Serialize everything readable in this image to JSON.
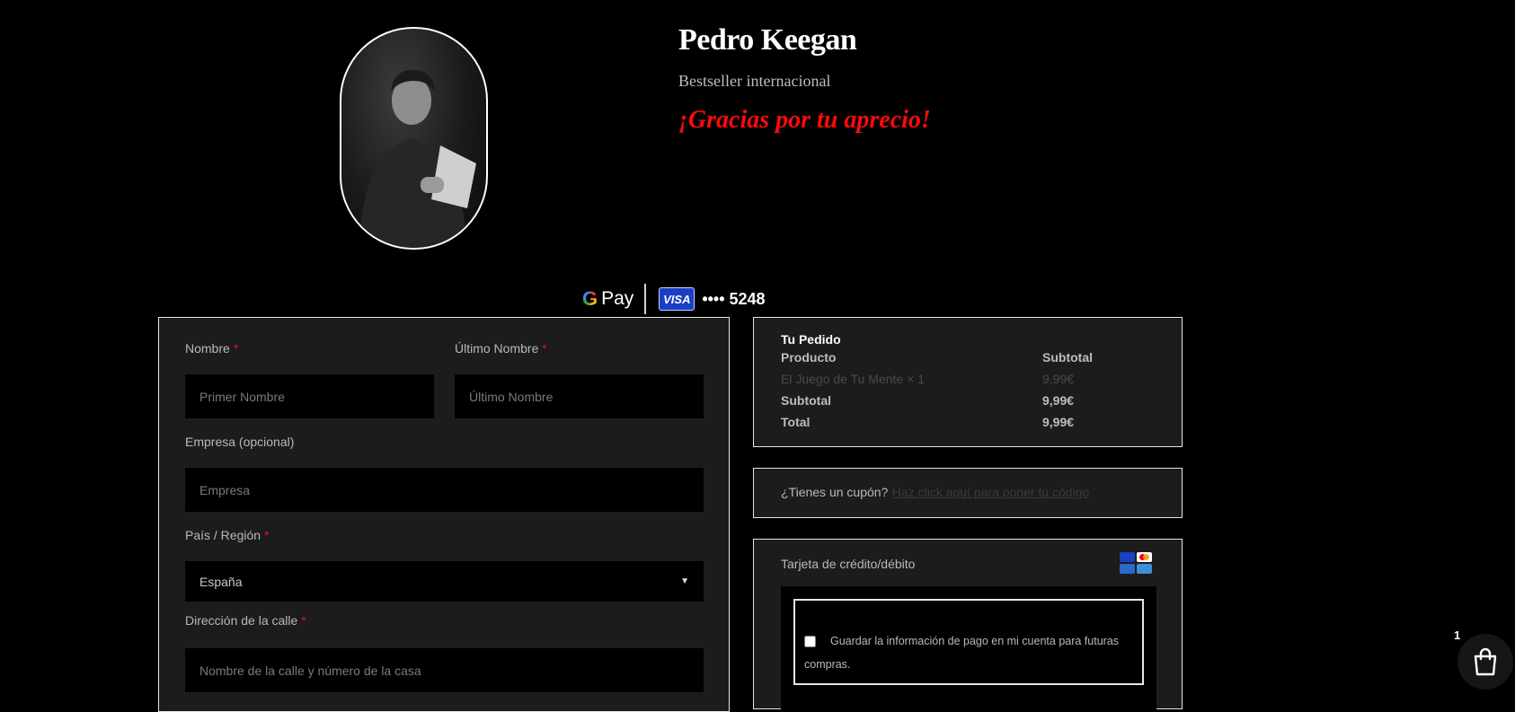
{
  "author": {
    "name": "Pedro Keegan",
    "subtitle": "Bestseller internacional",
    "thanks": "¡Gracias por tu aprecio!"
  },
  "payment_strip": {
    "gpay_label": "Pay",
    "card_brand": "VISA",
    "card_last": "•••• 5248"
  },
  "billing": {
    "first_name": {
      "label": "Nombre",
      "required": "*",
      "placeholder": "Primer Nombre"
    },
    "last_name": {
      "label": "Último Nombre",
      "required": "*",
      "placeholder": "Último Nombre"
    },
    "company": {
      "label": "Empresa (opcional)",
      "placeholder": "Empresa"
    },
    "country": {
      "label": "País / Región",
      "required": "*",
      "value": "España"
    },
    "street": {
      "label": "Dirección de la calle",
      "required": "*",
      "placeholder": "Nombre de la calle y número de la casa"
    }
  },
  "order": {
    "title": "Tu Pedido",
    "headers": {
      "product": "Producto",
      "subtotal": "Subtotal"
    },
    "items": [
      {
        "name": "El Juego de Tu Mente",
        "qty": " × 1",
        "price": "9,99€"
      }
    ],
    "subtotal_label": "Subtotal",
    "subtotal_value": "9,99€",
    "total_label": "Total",
    "total_value": "9,99€"
  },
  "coupon": {
    "question": "¿Tienes un cupón?",
    "link": "Haz click aquí para poner tu código"
  },
  "card_payment": {
    "title": "Tarjeta de crédito/débito",
    "save_info": "Guardar la información de pago en mi cuenta para futuras compras."
  },
  "cart": {
    "count": "1"
  }
}
